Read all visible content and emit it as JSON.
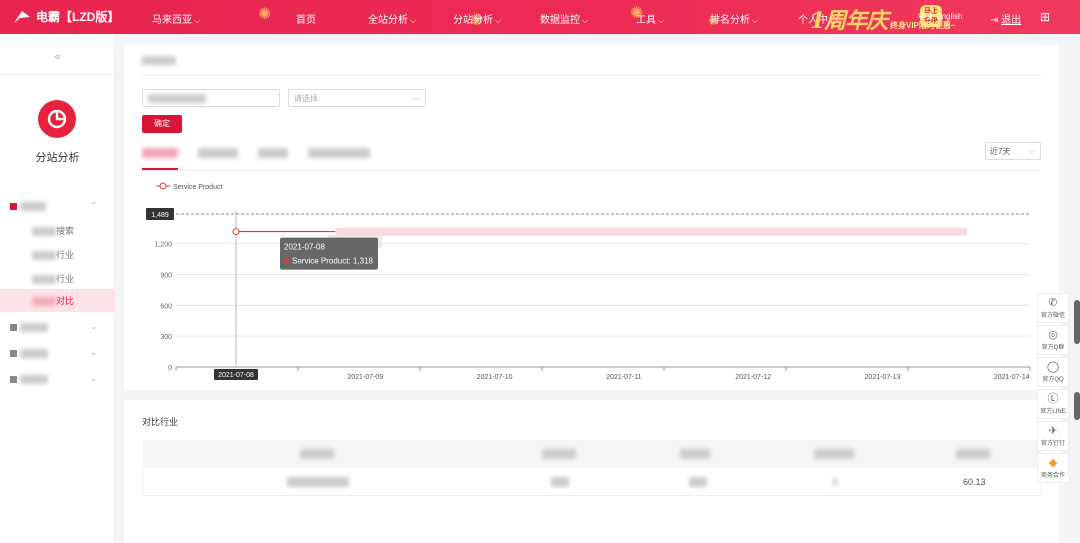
{
  "header": {
    "logo_text": "电霸【LZD版】",
    "nav": [
      {
        "label": "马来西亚",
        "has_dropdown": true
      },
      {
        "label": "首页",
        "has_dropdown": false
      },
      {
        "label": "全站分析",
        "has_dropdown": true
      },
      {
        "label": "分站分析",
        "has_dropdown": true
      },
      {
        "label": "数据监控",
        "has_dropdown": true
      },
      {
        "label": "工具",
        "has_dropdown": true
      },
      {
        "label": "排名分析",
        "has_dropdown": true
      },
      {
        "label": "个人中心",
        "has_dropdown": false
      }
    ],
    "promo": {
      "big_text": "1周年庆",
      "button": "马上升级",
      "sub": "终身VIP限时钜惠~"
    },
    "lang_zh": "中文",
    "lang_en": "English",
    "logout": "退出",
    "colors": {
      "bar": "#e8254d",
      "accent": "#d9153a"
    }
  },
  "sidebar": {
    "collapse_glyph": "«",
    "module_title": "分站分析",
    "items": [
      {
        "label": "行业分析",
        "expanded": true
      },
      {
        "label": "产品分析"
      },
      {
        "label": "店铺分析"
      },
      {
        "label": "趋势分析"
      }
    ],
    "subitems": [
      "搜索",
      "行业",
      "行业",
      "对比"
    ],
    "active_subitem": "对比"
  },
  "filter": {
    "select_placeholder": "请选择",
    "confirm_label": "确定",
    "range_label": "近7天"
  },
  "chart_data": {
    "type": "line",
    "title": "",
    "legend": [
      "Service Product"
    ],
    "x": [
      "2021-07-08",
      "2021-07-09",
      "2021-07-10",
      "2021-07-11",
      "2021-07-12",
      "2021-07-13",
      "2021-07-14"
    ],
    "series": [
      {
        "name": "Service Product",
        "values": [
          1318,
          1318,
          1318,
          1318,
          1318,
          1318,
          1318
        ]
      }
    ],
    "yticks": [
      0,
      300,
      600,
      900,
      1200
    ],
    "ylim": [
      0,
      1489
    ],
    "max_marker": 1489,
    "tooltip": {
      "date": "2021-07-08",
      "text": "Service Product: 1,318"
    },
    "hover_x_label": "2021-07-08",
    "grid": true,
    "colors": {
      "line": "#e23a3a"
    }
  },
  "compare": {
    "title": "对比行业",
    "value": "60.13"
  },
  "floatbar": [
    {
      "icon": "wechat-icon",
      "glyph": "✆",
      "label": "官方微信"
    },
    {
      "icon": "qq-group-icon",
      "glyph": "◎",
      "label": "官方Q群"
    },
    {
      "icon": "qq-icon",
      "glyph": "◯",
      "label": "官方QQ"
    },
    {
      "icon": "line-icon",
      "glyph": "Ⓛ",
      "label": "官方LINE"
    },
    {
      "icon": "dingtalk-icon",
      "glyph": "✈",
      "label": "官方钉钉"
    },
    {
      "icon": "diamond-icon",
      "glyph": "◆",
      "label": "商务合作"
    }
  ]
}
